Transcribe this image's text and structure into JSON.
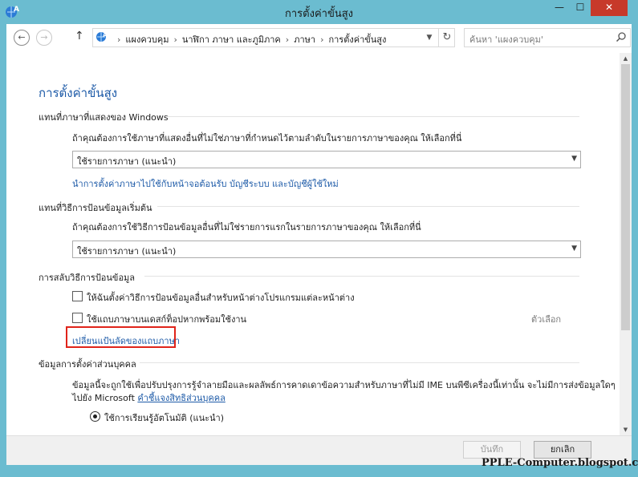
{
  "window": {
    "title": "การตั้งค่าขั้นสูง",
    "minimize": "—",
    "maximize": "☐",
    "close": "✕"
  },
  "nav": {
    "back": "←",
    "forward": "→",
    "up": "↑",
    "breadcrumbs": [
      "แผงควบคุม",
      "นาฬิกา ภาษา และภูมิภาค",
      "ภาษา",
      "การตั้งค่าขั้นสูง"
    ],
    "separator": "›",
    "search_placeholder": "ค้นหา 'แผงควบคุม'"
  },
  "page": {
    "title": "การตั้งค่าขั้นสูง",
    "display_section": {
      "heading": "แทนที่ภาษาที่แสดงของ Windows",
      "desc": "ถ้าคุณต้องการใช้ภาษาที่แสดงอื่นที่ไม่ใช่ภาษาที่กำหนดไว้ตามลำดับในรายการภาษาของคุณ ให้เลือกที่นี่",
      "select_value": "ใช้รายการภาษา (แนะนำ)",
      "link": "นำการตั้งค่าภาษาไปใช้กับหน้าจอต้อนรับ บัญชีระบบ และบัญชีผู้ใช้ใหม่"
    },
    "input_section": {
      "heading": "แทนที่วิธีการป้อนข้อมูลเริ่มต้น",
      "desc": "ถ้าคุณต้องการใช้วิธีการป้อนข้อมูลอื่นที่ไม่ใช่รายการแรกในรายการภาษาของคุณ ให้เลือกที่นี่",
      "select_value": "ใช้รายการภาษา (แนะนำ)"
    },
    "switch_section": {
      "heading": "การสลับวิธีการป้อนข้อมูล",
      "checkbox1": "ให้ฉันตั้งค่าวิธีการป้อนข้อมูลอื่นสำหรับหน้าต่างโปรแกรมแต่ละหน้าต่าง",
      "checkbox2": "ใช้แถบภาษาบนเดสก์ท็อปหากพร้อมใช้งาน",
      "options_link": "ตัวเลือก",
      "hotkey_link": "เปลี่ยนแป้นลัดของแถบภาษา"
    },
    "personal_section": {
      "heading": "ข้อมูลการตั้งค่าส่วนบุคคล",
      "desc_line1": "ข้อมูลนี้จะถูกใช้เพื่อปรับปรุงการรู้จำลายมือและผลลัพธ์การคาดเดาข้อความสำหรับภาษาที่ไม่มี IME บนพีซีเครื่องนี้เท่านั้น จะไม่มีการส่งข้อมูลใดๆ",
      "desc_line2_prefix": "ไปยัง Microsoft",
      "privacy_link": "คำชี้แจงสิทธิส่วนบุคคล",
      "radio1": "ใช้การเรียนรู้อัตโนมัติ (แนะนำ)"
    }
  },
  "footer": {
    "apply": "บันทึก",
    "cancel": "ยกเลิก"
  },
  "watermark": "PPLE-Computer.blogspot.com"
}
